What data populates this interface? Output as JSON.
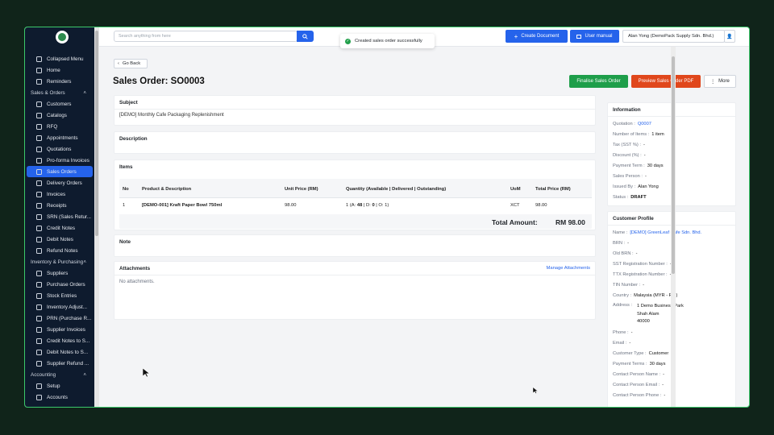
{
  "sidebar": {
    "top_items": [
      {
        "label": "Collapsed Menu",
        "icon": "menu-icon"
      },
      {
        "label": "Home",
        "icon": "home-icon"
      },
      {
        "label": "Reminders",
        "icon": "clock-icon"
      }
    ],
    "sections": [
      {
        "title": "Sales & Orders",
        "items": [
          "Customers",
          "Catalogs",
          "RFQ",
          "Appointments",
          "Quotations",
          "Pro-forma Invoices",
          "Sales Orders",
          "Delivery Orders",
          "Invoices",
          "Receipts",
          "SRN (Sales Retur...",
          "Credit Notes",
          "Debit Notes",
          "Refund Notes"
        ]
      },
      {
        "title": "Inventory & Purchasing",
        "items": [
          "Suppliers",
          "Purchase Orders",
          "Stock Entries",
          "Inventory Adjust...",
          "PRN (Purchase R...",
          "Supplier Invoices",
          "Credit Notes to S...",
          "Debit Notes to S...",
          "Supplier Refund ..."
        ]
      },
      {
        "title": "Accounting",
        "items": [
          "Setup",
          "Accounts"
        ]
      }
    ],
    "active": "Sales Orders"
  },
  "topbar": {
    "search_placeholder": "Search anything from here",
    "create_document": "Create Document",
    "user_manual": "User manual",
    "user_name": "Alan Yong  (DemoPack Supply Sdn. Bhd.)"
  },
  "toast": {
    "message": "Created sales order successfully"
  },
  "header": {
    "back": "Go Back",
    "title": "Sales Order: SO0003",
    "finalise": "Finalise Sales Order",
    "preview_pdf": "Preview Sales Order PDF",
    "more": "More"
  },
  "subject": {
    "heading": "Subject",
    "value": "[DEMO] Monthly Cafe Packaging Replenishment"
  },
  "description": {
    "heading": "Description"
  },
  "items": {
    "heading": "Items",
    "columns": [
      "No",
      "Product & Description",
      "Unit Price (RM)",
      "Quantity (Available | Delivered | Outstanding)",
      "UoM",
      "Total Price (RM)"
    ],
    "rows": [
      {
        "no": "1",
        "product": "[DEMO-001] Kraft Paper Bowl 750ml",
        "unit_price": "98.00",
        "qty_prefix": "1 (A: ",
        "qty_avail": "48",
        "qty_mid": " | D: ",
        "qty_deliv": "0",
        "qty_mid2": " | O: 1)",
        "uom": "XCT",
        "total": "98.00"
      }
    ],
    "total_label": "Total Amount:",
    "total_value": "RM 98.00"
  },
  "note": {
    "heading": "Note"
  },
  "attachments": {
    "heading": "Attachments",
    "manage": "Manage Attachments",
    "empty": "No attachments."
  },
  "information": {
    "heading": "Information",
    "quotation_label": "Quotation :",
    "quotation_value": "Q0007",
    "rows": [
      {
        "k": "Number of Items :",
        "v": "1 item"
      },
      {
        "k": "Tax (SST %) :",
        "v": "-"
      },
      {
        "k": "Discount (%) :",
        "v": "-"
      },
      {
        "k": "Payment Term :",
        "v": "30 days"
      },
      {
        "k": "Sales Person :",
        "v": "-"
      },
      {
        "k": "Issued By :",
        "v": "Alan Yong"
      }
    ],
    "status_label": "Status :",
    "status_value": "DRAFT"
  },
  "customer": {
    "heading": "Customer Profile",
    "name_label": "Name :",
    "name_value": "[DEMO] GreenLeaf Cafe Sdn. Bhd.",
    "rows_a": [
      {
        "k": "BRN :",
        "v": "-"
      },
      {
        "k": "Old BRN :",
        "v": "-"
      },
      {
        "k": "SST Registration Number :",
        "v": "-"
      },
      {
        "k": "TTX Registration Number :",
        "v": "-"
      },
      {
        "k": "TIN Number :",
        "v": "-"
      },
      {
        "k": "Country :",
        "v": "Malaysia (MYR - RM)"
      }
    ],
    "address_label": "Address :",
    "address_lines": [
      "1 Demo Business Park",
      "Shah Alam",
      "40000"
    ],
    "rows_b": [
      {
        "k": "Phone :",
        "v": "-"
      },
      {
        "k": "Email :",
        "v": "-"
      },
      {
        "k": "Customer Type :",
        "v": "Customer"
      },
      {
        "k": "Payment Terms :",
        "v": "30 days"
      },
      {
        "k": "Contact Person Name :",
        "v": "-"
      },
      {
        "k": "Contact Person Email :",
        "v": "-"
      },
      {
        "k": "Contact Person Phone :",
        "v": "-"
      }
    ]
  }
}
